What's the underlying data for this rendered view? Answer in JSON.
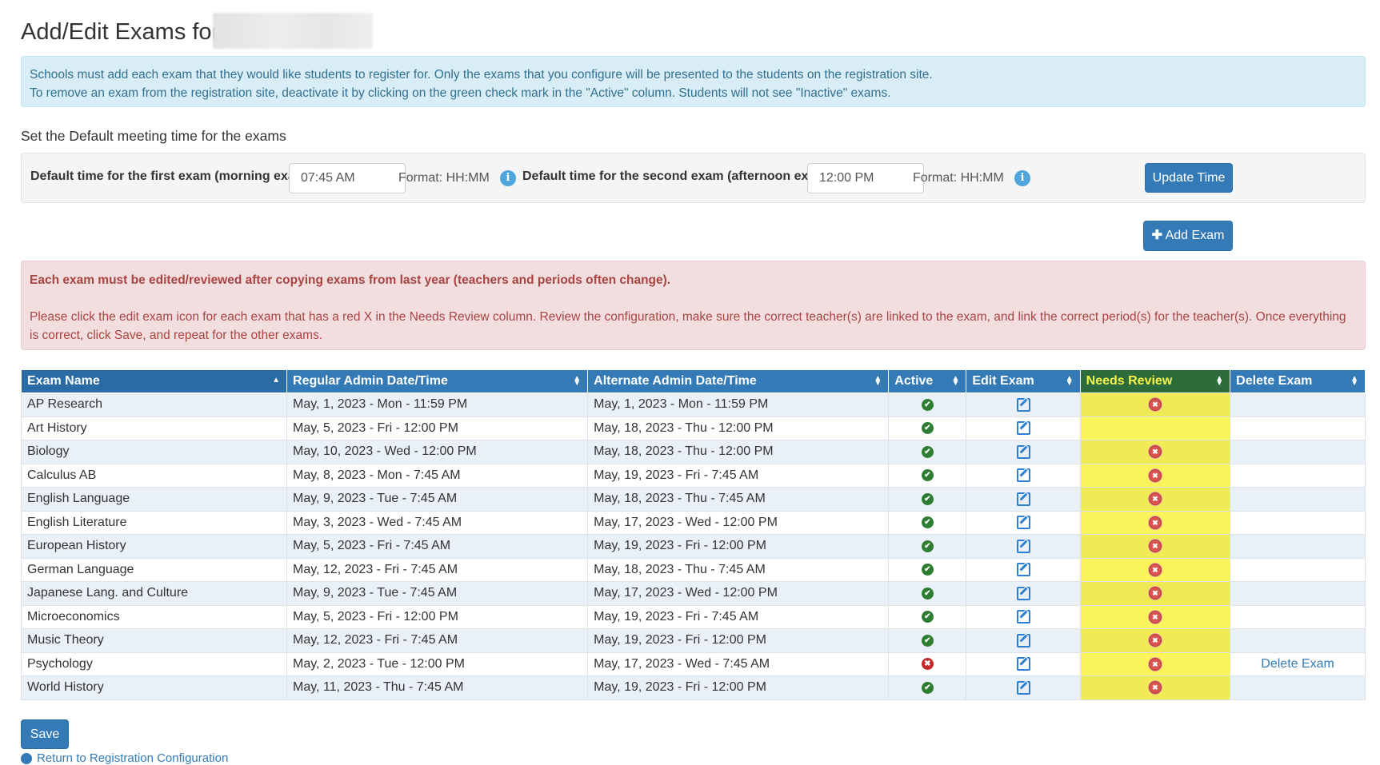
{
  "page": {
    "title": "Add/Edit Exams for"
  },
  "info_alert": {
    "line1": "Schools must add each exam that they would like students to register for. Only the exams that you configure will be presented to the students on the registration site.",
    "line2": "To remove an exam from the registration site, deactivate it by clicking on the green check mark in the \"Active\" column. Students will not see \"Inactive\" exams."
  },
  "default_time": {
    "section_label": "Set the Default meeting time for the exams",
    "first_label": "Default time for the first exam (morning exam)",
    "first_value": "07:45 AM",
    "first_format": "Format: HH:MM",
    "second_label": "Default time for the second exam (afternoon exam)",
    "second_value": "12:00 PM",
    "second_format": "Format: HH:MM",
    "info_icon": "info-icon",
    "update_button": "Update Time"
  },
  "add_exam_button": "Add Exam",
  "danger_alert": {
    "heading": "Each exam must be edited/reviewed after copying exams from last year (teachers and periods often change).",
    "body": "Please click the edit exam icon for each exam that has a red X in the Needs Review column. Review the configuration, make sure the correct teacher(s) are linked to the exam, and link the correct period(s) for the teacher(s). Once everything is correct, click Save, and repeat for the other exams."
  },
  "table": {
    "columns": [
      "Exam Name",
      "Regular Admin Date/Time",
      "Alternate Admin Date/Time",
      "Active",
      "Edit Exam",
      "Needs Review",
      "Delete Exam"
    ],
    "highlight_color": "#faf35a",
    "rows": [
      {
        "name": "AP Research",
        "regular": "May, 1, 2023 - Mon - 11:59 PM",
        "alternate": "May, 1, 2023 - Mon - 11:59 PM",
        "active": true,
        "needs_review": true,
        "delete": ""
      },
      {
        "name": "Art History",
        "regular": "May, 5, 2023 - Fri - 12:00 PM",
        "alternate": "May, 18, 2023 - Thu - 12:00 PM",
        "active": true,
        "needs_review": false,
        "delete": ""
      },
      {
        "name": "Biology",
        "regular": "May, 10, 2023 - Wed - 12:00 PM",
        "alternate": "May, 18, 2023 - Thu - 12:00 PM",
        "active": true,
        "needs_review": true,
        "delete": ""
      },
      {
        "name": "Calculus AB",
        "regular": "May, 8, 2023 - Mon - 7:45 AM",
        "alternate": "May, 19, 2023 - Fri - 7:45 AM",
        "active": true,
        "needs_review": true,
        "delete": ""
      },
      {
        "name": "English Language",
        "regular": "May, 9, 2023 - Tue - 7:45 AM",
        "alternate": "May, 18, 2023 - Thu - 7:45 AM",
        "active": true,
        "needs_review": true,
        "delete": ""
      },
      {
        "name": "English Literature",
        "regular": "May, 3, 2023 - Wed - 7:45 AM",
        "alternate": "May, 17, 2023 - Wed - 12:00 PM",
        "active": true,
        "needs_review": true,
        "delete": ""
      },
      {
        "name": "European History",
        "regular": "May, 5, 2023 - Fri - 7:45 AM",
        "alternate": "May, 19, 2023 - Fri - 12:00 PM",
        "active": true,
        "needs_review": true,
        "delete": ""
      },
      {
        "name": "German Language",
        "regular": "May, 12, 2023 - Fri - 7:45 AM",
        "alternate": "May, 18, 2023 - Thu - 7:45 AM",
        "active": true,
        "needs_review": true,
        "delete": ""
      },
      {
        "name": "Japanese Lang. and Culture",
        "regular": "May, 9, 2023 - Tue - 7:45 AM",
        "alternate": "May, 17, 2023 - Wed - 12:00 PM",
        "active": true,
        "needs_review": true,
        "delete": ""
      },
      {
        "name": "Microeconomics",
        "regular": "May, 5, 2023 - Fri - 12:00 PM",
        "alternate": "May, 19, 2023 - Fri - 7:45 AM",
        "active": true,
        "needs_review": true,
        "delete": ""
      },
      {
        "name": "Music Theory",
        "regular": "May, 12, 2023 - Fri - 7:45 AM",
        "alternate": "May, 19, 2023 - Fri - 12:00 PM",
        "active": true,
        "needs_review": true,
        "delete": ""
      },
      {
        "name": "Psychology",
        "regular": "May, 2, 2023 - Tue - 12:00 PM",
        "alternate": "May, 17, 2023 - Wed - 7:45 AM",
        "active": false,
        "needs_review": true,
        "delete": "Delete Exam"
      },
      {
        "name": "World History",
        "regular": "May, 11, 2023 - Thu - 7:45 AM",
        "alternate": "May, 19, 2023 - Fri - 12:00 PM",
        "active": true,
        "needs_review": true,
        "delete": ""
      }
    ]
  },
  "save_button": "Save",
  "back_link": "Return to Registration Configuration"
}
